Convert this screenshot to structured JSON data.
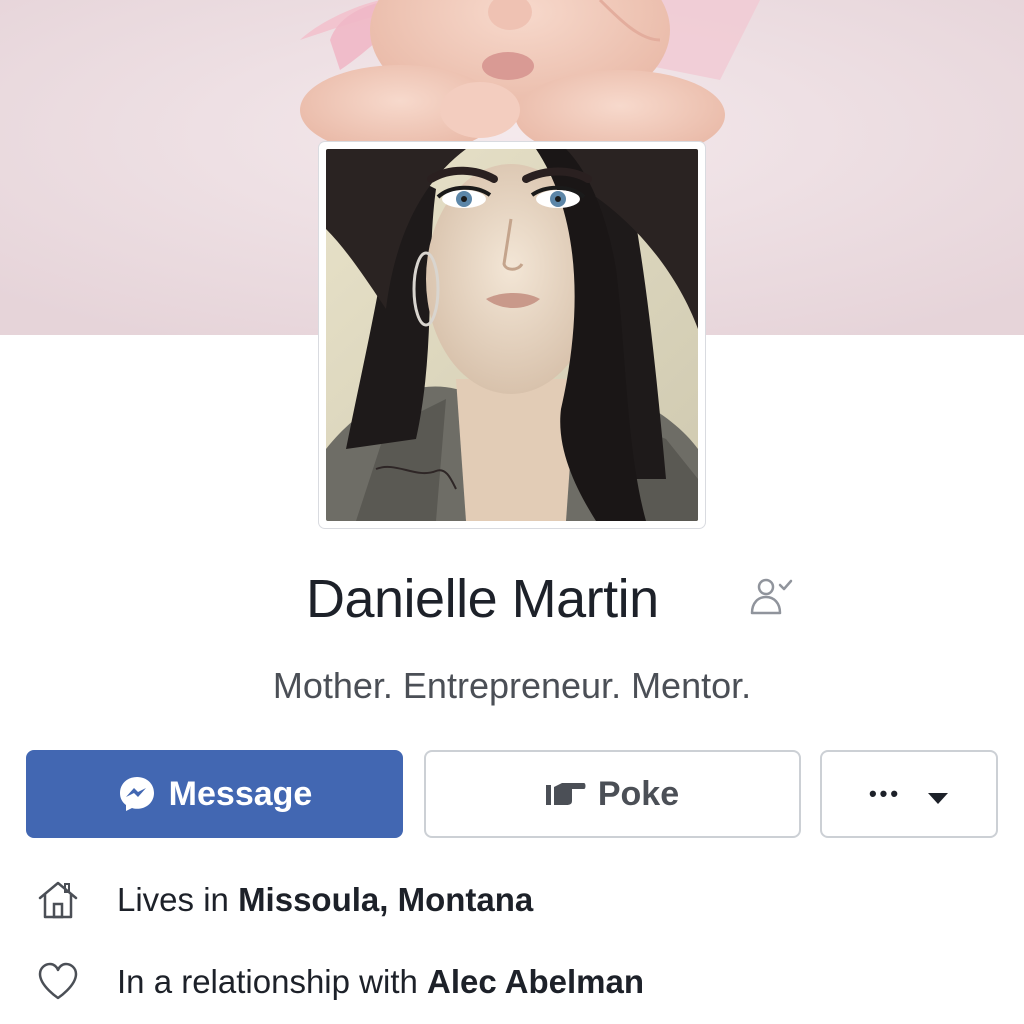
{
  "profile": {
    "name": "Danielle Martin",
    "bio": "Mother. Entrepreneur. Mentor."
  },
  "actions": {
    "message_label": "Message",
    "poke_label": "Poke",
    "more_label": "•••"
  },
  "info": [
    {
      "prefix": "Lives in",
      "value": "Missoula, Montana",
      "icon": "home-icon"
    },
    {
      "prefix": "In a relationship with",
      "value": "Alec Abelman",
      "icon": "heart-icon"
    }
  ],
  "colors": {
    "brand": "#4267b2",
    "text": "#1d2129",
    "secondary_text": "#4b4f56",
    "border": "#ccd0d5"
  },
  "icons": {
    "follow": "person-check-icon",
    "messenger": "messenger-icon",
    "poke": "pointing-hand-icon",
    "more_caret": "caret-down-icon"
  }
}
